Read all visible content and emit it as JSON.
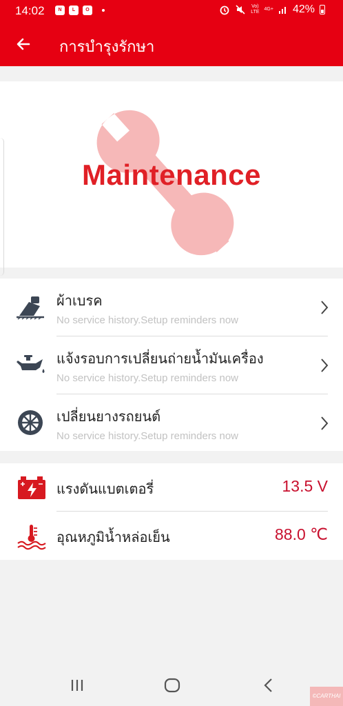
{
  "status": {
    "time": "14:02",
    "net_top": "Vo)",
    "net_bottom": "LTE",
    "signal_label": "4G+",
    "battery_percent": "42%"
  },
  "appbar": {
    "title": "การบำรุงรักษา"
  },
  "hero": {
    "title": "Maintenance"
  },
  "maintenance_items": [
    {
      "label": "ผ้าเบรค",
      "subtitle": "No service history.Setup reminders now",
      "icon": "brake-pedal-icon"
    },
    {
      "label": "แจ้งรอบการเปลี่ยนถ่ายน้ำมันเครื่อง",
      "subtitle": "No service history.Setup reminders now",
      "icon": "oil-can-icon"
    },
    {
      "label": "เปลี่ยนยางรถยนต์",
      "subtitle": "No service history.Setup reminders now",
      "icon": "tire-icon"
    }
  ],
  "readings": [
    {
      "label": "แรงดันแบตเตอรี่",
      "value": "13.5 V",
      "icon": "battery-icon"
    },
    {
      "label": "อุณหภูมิน้ำหล่อเย็น",
      "value": "88.0 ℃",
      "icon": "coolant-temperature-icon"
    }
  ],
  "watermark": "©CARTHAI",
  "colors": {
    "accent": "#e60012",
    "value_text": "#c8102e",
    "icon_dark": "#3c4654",
    "subtitle": "#c2c2c2"
  }
}
